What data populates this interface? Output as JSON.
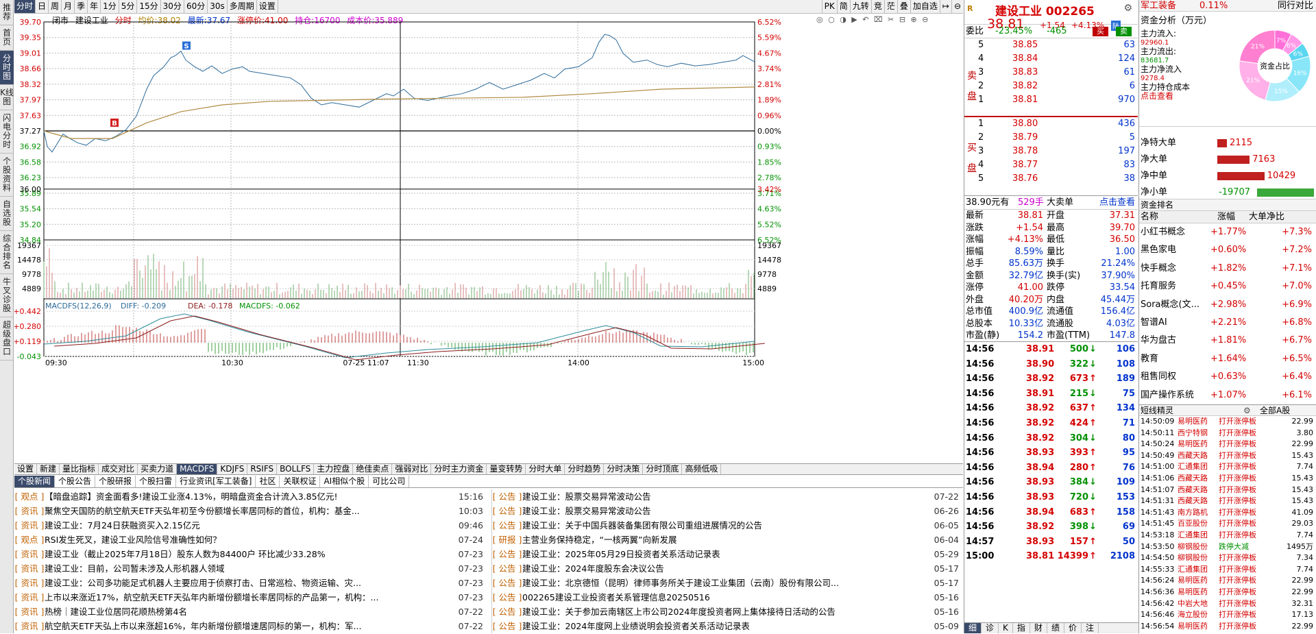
{
  "sidebar": [
    "推荐",
    "首页",
    "分时图",
    "K线图",
    "闪电分时",
    "个股资料",
    "自选股",
    "综合排名",
    "牛叉诊股",
    "超级盘口"
  ],
  "topbar": {
    "periods": [
      "分时",
      "日",
      "周",
      "月",
      "季",
      "年",
      "1分",
      "5分",
      "15分",
      "30分",
      "60分",
      "30s",
      "多周期",
      "设置"
    ],
    "right": [
      "PK",
      "简",
      "九转",
      "竞",
      "茫",
      "叠",
      "加自选"
    ]
  },
  "info": {
    "state": "闭市",
    "name": "建设工业",
    "mode": "分时",
    "avg_label": "均价:38.02",
    "last_label": "最新:37.67",
    "limit_label": "涨停价:41.00",
    "hold_label": "持仓:16700",
    "cost_label": "成本价:35.889"
  },
  "chart_data": {
    "type": "line",
    "prev_close": 37.27,
    "y_ticks": [
      "39.70",
      "39.35",
      "39.01",
      "38.66",
      "38.32",
      "37.97",
      "37.63",
      "37.27",
      "36.92",
      "36.58",
      "36.23",
      "35.89",
      "35.54",
      "35.20",
      "34.84"
    ],
    "pct_ticks": [
      "6.52%",
      "5.59%",
      "4.67%",
      "3.74%",
      "2.81%",
      "1.89%",
      "0.96%",
      "0.00%",
      "0.93%",
      "1.85%",
      "2.78%",
      "3.71%",
      "4.63%",
      "5.52%",
      "6.52%"
    ],
    "cost_line": "36.00",
    "cost_pct": "3.42%",
    "x_labels": [
      "09:30",
      "10:30",
      "07-25 11:07",
      "11:30",
      "14:00",
      "15:00"
    ],
    "vol_ticks": [
      "19367",
      "14478",
      "9778",
      "4889"
    ],
    "macd_ticks": [
      "+0.442",
      "+0.280",
      "+0.119",
      "-0.043"
    ],
    "macd_label": "MACDFS(12,26,9)",
    "diff_label": "DIFF: -0.209",
    "dea_label": "DEA: -0.178",
    "macd_val_label": "MACDFS: -0.062",
    "markers": [
      "B",
      "S"
    ]
  },
  "bottom_tabs": [
    "设置",
    "新建",
    "量比指标",
    "成交对比",
    "买卖力道",
    "MACDFS",
    "KDJFS",
    "RSIFS",
    "BOLLFS",
    "主力控盘",
    "绝佳卖点",
    "强弱对比",
    "分时主力资金",
    "量变转势",
    "分时大单",
    "分时趋势",
    "分时决策",
    "分时顶底",
    "高频低吸"
  ],
  "news_tabs": [
    "个股新闻",
    "个股公告",
    "个股研报",
    "个股扫雷",
    "行业资讯[军工装备]",
    "社区",
    "关联权证",
    "AI相似个股",
    "可比公司"
  ],
  "news_left": [
    {
      "tag": "观点",
      "text": "【暗盘追踪】资金面看多!建设工业涨4.13%，明暗盘资金合计流入3.85亿元!",
      "date": "15:16"
    },
    {
      "tag": "资讯",
      "text": "聚焦空天国防的航空航天ETF天弘年初至今份额增长率居同标的首位，机构：基金...",
      "date": "10:03"
    },
    {
      "tag": "资讯",
      "text": "建设工业：7月24日获融资买入2.15亿元",
      "date": "09:46"
    },
    {
      "tag": "观点",
      "text": "RSI发生死叉，建设工业风险信号准确性如何？",
      "date": "07-24"
    },
    {
      "tag": "资讯",
      "text": "建设工业（截止2025年7月18日）股东人数为84400户 环比减少33.28%",
      "date": "07-23"
    },
    {
      "tag": "资讯",
      "text": "建设工业：目前，公司暂未涉及人形机器人领域",
      "date": "07-23"
    },
    {
      "tag": "资讯",
      "text": "建设工业：公司多功能足式机器人主要应用于侦察打击、日常巡检、物资运输、灾...",
      "date": "07-23"
    },
    {
      "tag": "资讯",
      "text": "上市以来涨近17%，航空航天ETF天弘年内新增份额增长率居同标的产品第一，机构：...",
      "date": "07-23"
    },
    {
      "tag": "资讯",
      "text": "热榜｜建设工业位居同花顺热榜第4名",
      "date": "07-22"
    },
    {
      "tag": "资讯",
      "text": "航空航天ETF天弘上市以来涨超16%，年内新增份额增速居同标的第一，机构：军...",
      "date": "07-22"
    }
  ],
  "news_right": [
    {
      "tag": "公告",
      "text": "建设工业：股票交易异常波动公告",
      "date": "07-22"
    },
    {
      "tag": "公告",
      "text": "建设工业：股票交易异常波动公告",
      "date": "06-26"
    },
    {
      "tag": "公告",
      "text": "建设工业：关于中国兵器装备集团有限公司重组进展情况的公告",
      "date": "06-05"
    },
    {
      "tag": "研报",
      "text": "主营业务保持稳定，“一核两翼”向新发展",
      "date": "06-04"
    },
    {
      "tag": "公告",
      "text": "建设工业：2025年05月29日投资者关系活动记录表",
      "date": "05-29"
    },
    {
      "tag": "公告",
      "text": "建设工业：2024年度股东会决议公告",
      "date": "05-17"
    },
    {
      "tag": "公告",
      "text": "建设工业：北京德恒（昆明）律师事务所关于建设工业集团（云南）股份有限公司...",
      "date": "05-17"
    },
    {
      "tag": "公告",
      "text": "002265建设工业投资者关系管理信息20250516",
      "date": "05-16"
    },
    {
      "tag": "公告",
      "text": "建设工业：关于参加云南辖区上市公司2024年度投资者网上集体接待日活动的公告",
      "date": "05-16"
    },
    {
      "tag": "公告",
      "text": "建设工业：2024年度网上业绩说明会投资者关系活动记录表",
      "date": "05-09"
    }
  ],
  "quote": {
    "name": "建设工业 002265",
    "price": "38.81",
    "change": "+1.54",
    "pct": "+4.13%",
    "weibi_label": "委比",
    "weibi": "-23.45%",
    "weicha": "-465",
    "buy_btn": "买",
    "sell_btn": "卖",
    "sell_label": "卖盘",
    "buy_label": "买盘",
    "asks": [
      [
        "5",
        "38.85",
        "63"
      ],
      [
        "4",
        "38.84",
        "124"
      ],
      [
        "3",
        "38.83",
        "61"
      ],
      [
        "2",
        "38.82",
        "6"
      ],
      [
        "1",
        "38.81",
        "970"
      ]
    ],
    "bids": [
      [
        "1",
        "38.80",
        "436"
      ],
      [
        "2",
        "38.79",
        "5"
      ],
      [
        "3",
        "38.78",
        "197"
      ],
      [
        "4",
        "38.77",
        "83"
      ],
      [
        "5",
        "38.76",
        "38"
      ]
    ],
    "bigorder": {
      "price": "38.90元有",
      "qty": "529手",
      "label": "大卖单",
      "link": "点击查看"
    },
    "stats": [
      [
        "最新",
        "38.81",
        "开盘",
        "37.31"
      ],
      [
        "涨跌",
        "+1.54",
        "最高",
        "39.70"
      ],
      [
        "涨幅",
        "+4.13%",
        "最低",
        "36.50"
      ],
      [
        "振幅",
        "8.59%",
        "量比",
        "1.00"
      ],
      [
        "总手",
        "85.63万",
        "换手",
        "21.24%"
      ],
      [
        "金额",
        "32.79亿",
        "换手(实)",
        "37.90%"
      ],
      [
        "涨停",
        "41.00",
        "跌停",
        "33.54"
      ],
      [
        "外盘",
        "40.20万",
        "内盘",
        "45.44万"
      ],
      [
        "总市值",
        "400.9亿",
        "流通值",
        "156.4亿"
      ],
      [
        "总股本",
        "10.33亿",
        "流通股",
        "4.03亿"
      ],
      [
        "市盈(静)",
        "154.2",
        "市盈(TTM)",
        "147.8"
      ]
    ],
    "ticks": [
      [
        "14:56",
        "38.91",
        "500",
        "106"
      ],
      [
        "14:56",
        "38.90",
        "322",
        "108"
      ],
      [
        "14:56",
        "38.92",
        "673",
        "189"
      ],
      [
        "14:56",
        "38.91",
        "215",
        "75"
      ],
      [
        "14:56",
        "38.92",
        "637",
        "134"
      ],
      [
        "14:56",
        "38.92",
        "424",
        "71"
      ],
      [
        "14:56",
        "38.92",
        "304",
        "80"
      ],
      [
        "14:56",
        "38.93",
        "393",
        "95"
      ],
      [
        "14:56",
        "38.94",
        "280",
        "76"
      ],
      [
        "14:56",
        "38.93",
        "384",
        "109"
      ],
      [
        "14:56",
        "38.93",
        "720",
        "153"
      ],
      [
        "14:56",
        "38.94",
        "683",
        "158"
      ],
      [
        "14:56",
        "38.92",
        "398",
        "69"
      ],
      [
        "14:57",
        "38.93",
        "157",
        "50"
      ],
      [
        "15:00",
        "38.81",
        "14399",
        "2108"
      ]
    ],
    "tick_dirs": [
      "down",
      "down",
      "up",
      "down",
      "up",
      "up",
      "down",
      "up",
      "up",
      "down",
      "down",
      "up",
      "down",
      "up",
      "up"
    ],
    "bottom_tabs": [
      "细",
      "诊",
      "K",
      "指",
      "财",
      "绩",
      "价",
      "注"
    ]
  },
  "far": {
    "sector": "军工装备",
    "sector_pct": "0.11%",
    "sector_link": "同行对比",
    "fund_title": "资金分析（万元）",
    "main_in_label": "主力流入:",
    "main_in": "92960.1",
    "main_out_label": "主力流出:",
    "main_out": "83681.7",
    "main_net_label": "主力净流入",
    "main_net": "9278.4",
    "cost_label": "主力持仓成本",
    "cost_link": "点击查看",
    "pie_label": "资金占比",
    "pie_pcts": [
      "7%",
      "6%",
      "6%",
      "16%",
      "15%",
      "21%",
      "21%"
    ],
    "flows": [
      [
        "净特大单",
        "2115",
        2115
      ],
      [
        "净大单",
        "7163",
        7163
      ],
      [
        "净中单",
        "10429",
        10429
      ],
      [
        "净小单",
        "-19707",
        -19707
      ]
    ],
    "concept_title": "资金排名",
    "concept_cols": [
      "名称",
      "涨幅",
      "大单净比"
    ],
    "concepts": [
      [
        "小红书概念",
        "+1.77%",
        "+7.3%"
      ],
      [
        "黑色家电",
        "+0.60%",
        "+7.2%"
      ],
      [
        "快手概念",
        "+1.82%",
        "+7.1%"
      ],
      [
        "托育服务",
        "+0.45%",
        "+7.0%"
      ],
      [
        "Sora概念(文...",
        "+2.98%",
        "+6.9%"
      ],
      [
        "智谱AI",
        "+2.21%",
        "+6.8%"
      ],
      [
        "华为盘古",
        "+1.81%",
        "+6.7%"
      ],
      [
        "教育",
        "+1.64%",
        "+6.5%"
      ],
      [
        "租售同权",
        "+0.63%",
        "+6.4%"
      ],
      [
        "国产操作系统",
        "+1.07%",
        "+6.1%"
      ]
    ],
    "short_title": "短线精灵",
    "short_filter": "全部A股",
    "shorts": [
      [
        "14:50:09",
        "易明医药",
        "打开涨停板",
        "22.99"
      ],
      [
        "14:50:11",
        "西宁特钢",
        "打开涨停板",
        "3.80"
      ],
      [
        "14:50:24",
        "易明医药",
        "打开涨停板",
        "22.99"
      ],
      [
        "14:50:49",
        "西藏天路",
        "打开涨停板",
        "15.43"
      ],
      [
        "14:51:00",
        "汇通集团",
        "打开涨停板",
        "7.74"
      ],
      [
        "14:51:06",
        "西藏天路",
        "打开涨停板",
        "15.43"
      ],
      [
        "14:51:07",
        "西藏天路",
        "打开涨停板",
        "15.43"
      ],
      [
        "14:51:31",
        "西藏天路",
        "打开涨停板",
        "15.43"
      ],
      [
        "14:51:43",
        "南方路机",
        "打开涨停板",
        "41.09"
      ],
      [
        "14:51:45",
        "百亚股份",
        "打开涨停板",
        "29.03"
      ],
      [
        "14:53:18",
        "汇通集团",
        "打开涨停板",
        "7.74"
      ],
      [
        "14:53:50",
        "柳钢股份",
        "跌停大减",
        "1495万"
      ],
      [
        "14:54:50",
        "柳钢股份",
        "打开涨停板",
        "7.34"
      ],
      [
        "14:55:33",
        "汇通集团",
        "打开涨停板",
        "7.74"
      ],
      [
        "14:56:24",
        "易明医药",
        "打开涨停板",
        "22.99"
      ],
      [
        "14:56:36",
        "易明医药",
        "打开涨停板",
        "22.99"
      ],
      [
        "14:56:42",
        "中岩大地",
        "打开涨停板",
        "32.31"
      ],
      [
        "14:56:46",
        "海立股份",
        "打开涨停板",
        "17.13"
      ],
      [
        "14:56:54",
        "易明医药",
        "打开涨停板",
        "22.99"
      ]
    ]
  }
}
